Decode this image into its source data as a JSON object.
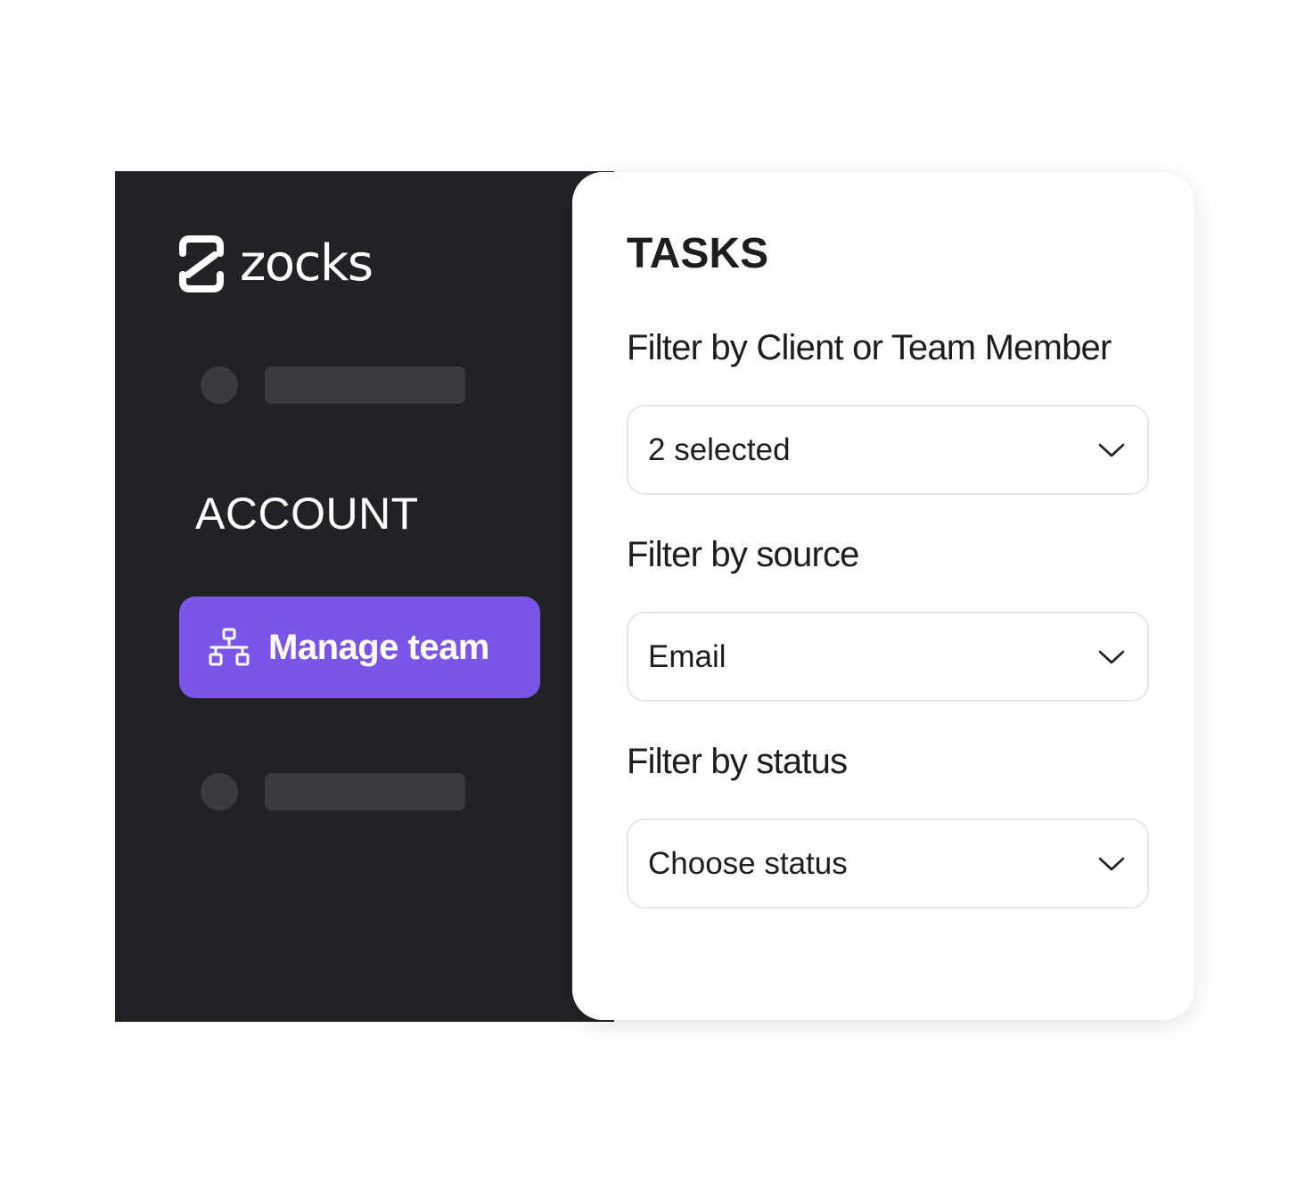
{
  "sidebar": {
    "logo_text": "zocks",
    "section_label": "ACCOUNT",
    "manage_team_label": "Manage team",
    "manage_team_icon": "org-chart-icon",
    "logo_icon": "zocks-logo-icon"
  },
  "panel": {
    "title": "TASKS",
    "filters": [
      {
        "label": "Filter by Client or Team Member",
        "value": "2 selected"
      },
      {
        "label": "Filter by source",
        "value": "Email"
      },
      {
        "label": "Filter by status",
        "value": "Choose status"
      }
    ]
  },
  "colors": {
    "sidebar_bg": "#212226",
    "placeholder": "#3a3b40",
    "accent": "#7b55e8",
    "panel_bg": "#ffffff",
    "text_dark": "#1d1d1f",
    "select_border": "#e6e6e8"
  }
}
